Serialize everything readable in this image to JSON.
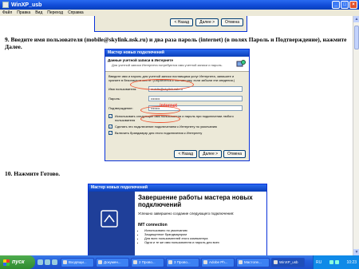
{
  "window": {
    "title": "WinXP_usb"
  },
  "menu": [
    "Файл",
    "Правка",
    "Вид",
    "Переход",
    "Справка"
  ],
  "top_dialog": {
    "back": "< Назад",
    "next": "Далее >",
    "cancel": "Отмена"
  },
  "step9": "9. Введите имя пользователя (mobile@skylink.nsk.ru) и два раза пароль (internet) (в полях Пароль и Подтверждение), нажмите Далее.",
  "dialog": {
    "title": "Мастер новых подключений",
    "header_title": "Данные учетной записи в Интернете",
    "header_sub": "Для учетной записи Интернета потребуются имя учетной записи и пароль.",
    "desc": "Введите имя и пароль для учетной записи поставщика услуг Интернета, запишите и храните в безопасном месте. (Обратитесь к поставщику, если забыли эти сведения.)",
    "username_label": "Имя пользователя:",
    "username_value": "mobile@skylink.nsk.ru",
    "password_label": "Пароль:",
    "password_value": "••••••••",
    "confirm_label": "Подтверждение:",
    "confirm_value": "••••••••",
    "chk1": "Использовать следующие имя пользователя и пароль при подключении любого пользователя",
    "chk2": "Сделать это подключение подключением к Интернету по умолчанию",
    "chk3": "Включить брандмауэр для этого подключения к Интернету",
    "back": "< Назад",
    "next": "Далее >",
    "cancel": "Отмена",
    "annotation": "internet"
  },
  "step10": "10. Нажмите Готово.",
  "dialog2": {
    "title": "Мастер новых подключений",
    "heading": "Завершение работы мастера новых подключений",
    "text": "Успешно завершено создание следующего подключения:",
    "connection": "IMT connection",
    "bullets": [
      "Использовано по умолчанию",
      "Защищенное брандмауэром",
      "Для всех пользователей этого компьютера",
      "Одни и те же имя пользователя и пароль для всех"
    ]
  },
  "taskbar": {
    "start": "пуск",
    "tasks": [
      "Входящи...",
      "Докумен...",
      "2 Прово...",
      "3 Прово...",
      "Adobe Ph...",
      "Мастопе...",
      "WinXP_usb"
    ],
    "lang": "RU",
    "clock": "10:23"
  }
}
